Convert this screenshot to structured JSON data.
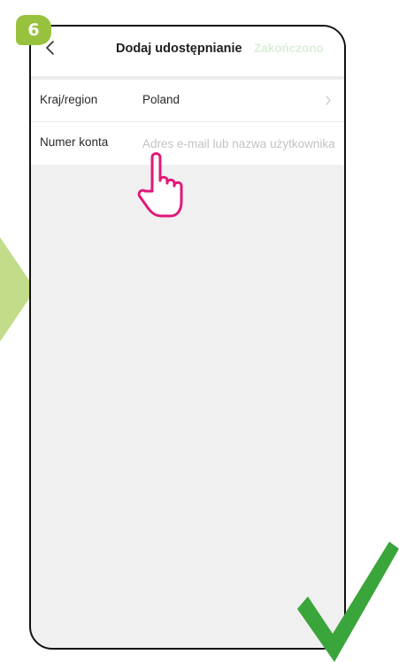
{
  "step": {
    "number": "6"
  },
  "header": {
    "title": "Dodaj udostępnianie",
    "done_label": "Zakończono",
    "back_icon": "chevron-left-icon"
  },
  "form": {
    "country_row": {
      "label": "Kraj/region",
      "value": "Poland",
      "icon": "chevron-right-icon"
    },
    "account_row": {
      "label": "Numer konta",
      "value": "",
      "placeholder": "Adres e-mail lub nazwa użytkownika"
    }
  },
  "decorations": {
    "pointer_icon": "hand-pointer-icon",
    "success_icon": "checkmark-icon",
    "arrow_icon": "arrow-right-icon"
  },
  "colors": {
    "badge": "#98c23d",
    "side_arrow": "#c3dc8a",
    "done_text": "#d9f0d7",
    "pointer": "#e0187a",
    "checkmark": "#3aa53a",
    "screen_background": "#f0f0f0"
  }
}
